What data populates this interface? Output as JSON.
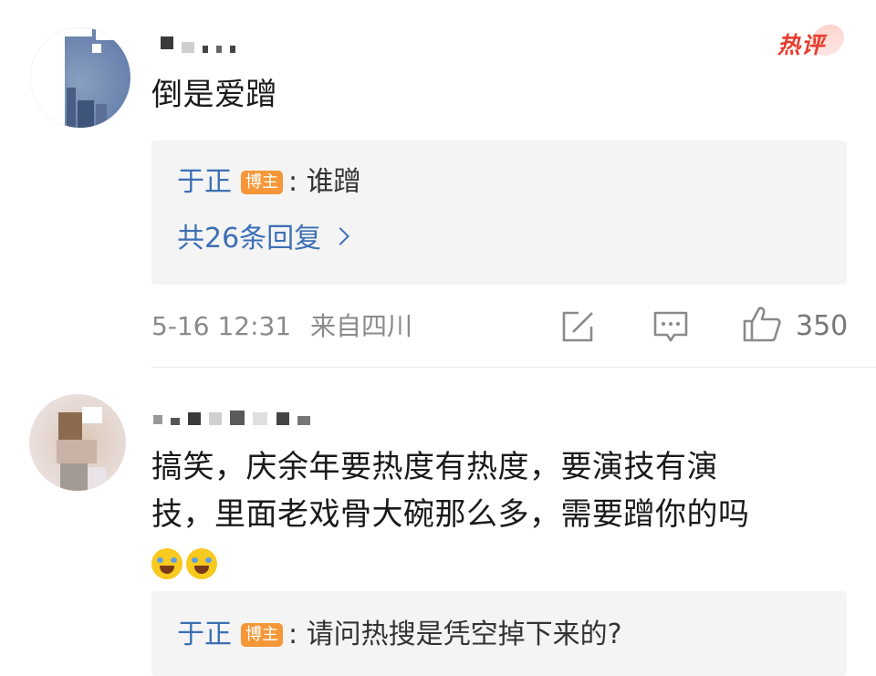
{
  "comments": [
    {
      "text": "倒是爱蹭",
      "badge": "热评",
      "reply": {
        "author": "于正",
        "badge": "博主",
        "sep": ":",
        "text": "谁蹭"
      },
      "reply_more": "共26条回复",
      "meta": {
        "date": "5-16 12:31",
        "location": "来自四川"
      },
      "actions": {
        "repost_icon": "share-icon",
        "comment_icon": "comment-icon",
        "like_icon": "thumbs-up-icon",
        "likes": "350"
      }
    },
    {
      "text_line1": "搞笑，庆余年要热度有热度，要演技有演",
      "text_line2": "技，里面老戏骨大碗那么多，需要蹭你的吗",
      "emoji": "laugh-cry-emoji",
      "reply": {
        "author": "于正",
        "badge": "博主",
        "sep": ":",
        "text": "请问热搜是凭空掉下来的?"
      }
    }
  ],
  "colors": {
    "link": "#3c6fb4",
    "badge": "#f59738",
    "hot": "#e63d2e",
    "meta": "#8a8a8a",
    "reply_bg": "#f4f4f4"
  }
}
